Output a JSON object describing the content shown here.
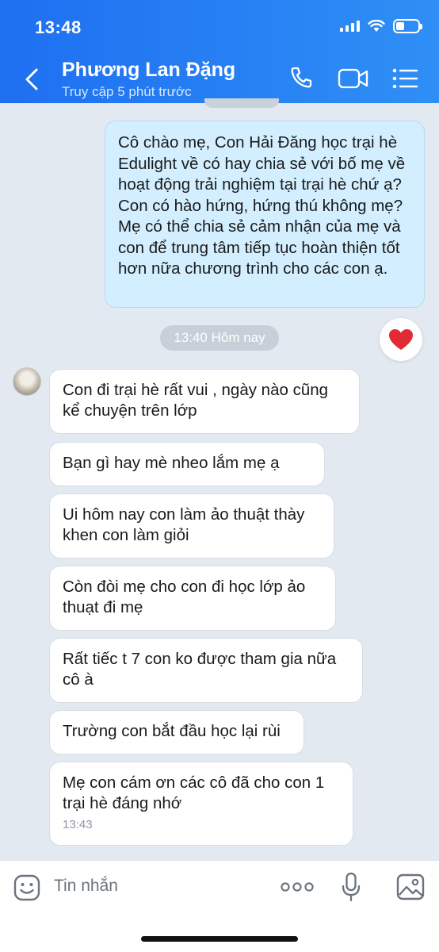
{
  "status_bar": {
    "time": "13:48"
  },
  "header": {
    "name": "Phương Lan Đặng",
    "status": "Truy cập 5 phút trước",
    "icons": [
      "back-icon",
      "phone-icon",
      "video-icon",
      "menu-icon"
    ]
  },
  "sent_message": {
    "text": "Cô chào mẹ, Con Hải Đăng học trại hè Edulight về có hay chia sẻ với bố mẹ về hoạt động trải nghiệm tại trại hè chứ ạ? Con có hào hứng, hứng thú không mẹ? Mẹ  có thể chia sẻ cảm nhận của mẹ và con để trung tâm tiếp tục hoàn thiện tốt hơn nữa chương trình cho các con ạ."
  },
  "time_separator": "13:40 Hôm nay",
  "reaction": "heart-icon",
  "received_messages": [
    {
      "text": "Con đi trại hè rất vui , ngày nào cũng kể chuyện trên lớp"
    },
    {
      "text": "Bạn gì hay mè nheo lắm mẹ ạ"
    },
    {
      "text": "Ui hôm nay con làm ảo thuật thày khen con làm giỏi"
    },
    {
      "text": "Còn đòi mẹ cho con đi học lớp ảo thuạt đi mẹ"
    },
    {
      "text": "Rất tiếc t 7 con ko được tham gia nữa cô à"
    },
    {
      "text": "Trường con bắt đầu học lại rùi"
    },
    {
      "text": "Mẹ con cám ơn các cô đã cho con 1 trại hè đáng nhớ",
      "time": "13:43"
    }
  ],
  "input": {
    "placeholder": "Tin nhắn"
  },
  "colors": {
    "header": "#1e6ff1",
    "sent_bubble": "#d3efff",
    "background": "#e2e9f1",
    "heart": "#e02b35"
  }
}
